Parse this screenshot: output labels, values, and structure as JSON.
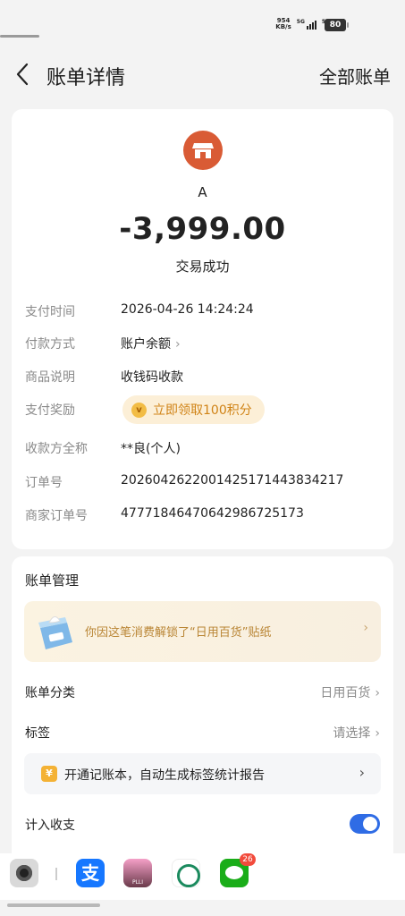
{
  "status_bar": {
    "net_speed_value": "954",
    "net_speed_unit": "KB/s",
    "signal1_label": "5G",
    "signal2_label": "5G",
    "battery": "80"
  },
  "nav": {
    "title": "账单详情",
    "right_link": "全部账单"
  },
  "transaction": {
    "merchant": "A",
    "amount": "-3,999.00",
    "status": "交易成功"
  },
  "details": [
    {
      "label": "支付时间",
      "value": "2026-04-26 14:24:24"
    },
    {
      "label": "付款方式",
      "value": "账户余额"
    },
    {
      "label": "商品说明",
      "value": "收钱码收款"
    },
    {
      "label": "支付奖励",
      "value": "立即领取100积分"
    },
    {
      "label": "收款方全称",
      "value": "**良(个人)"
    },
    {
      "label": "订单号",
      "value": "2026042622001425171443834217"
    },
    {
      "label": "商家订单号",
      "value": "47771846470642986725173"
    }
  ],
  "reward_coin": "v",
  "management": {
    "title": "账单管理",
    "banner_text": "你因这笔消费解锁了“日用百货”贴纸",
    "category_label": "账单分类",
    "category_value": "日用百货",
    "tag_label": "标签",
    "tag_value": "请选择",
    "promo_icon": "¥",
    "promo_text": "开通记账本，自动生成标签统计报告",
    "include_label": "计入收支",
    "include_enabled": true
  },
  "dock": {
    "alipay_glyph": "支",
    "photo_caption": "PLLI",
    "wechat_badge": "26"
  },
  "colors": {
    "accent_blue": "#2f6ce5",
    "shop_icon": "#d95b35",
    "reward_text": "#d08316",
    "banner_text": "#b98534"
  }
}
